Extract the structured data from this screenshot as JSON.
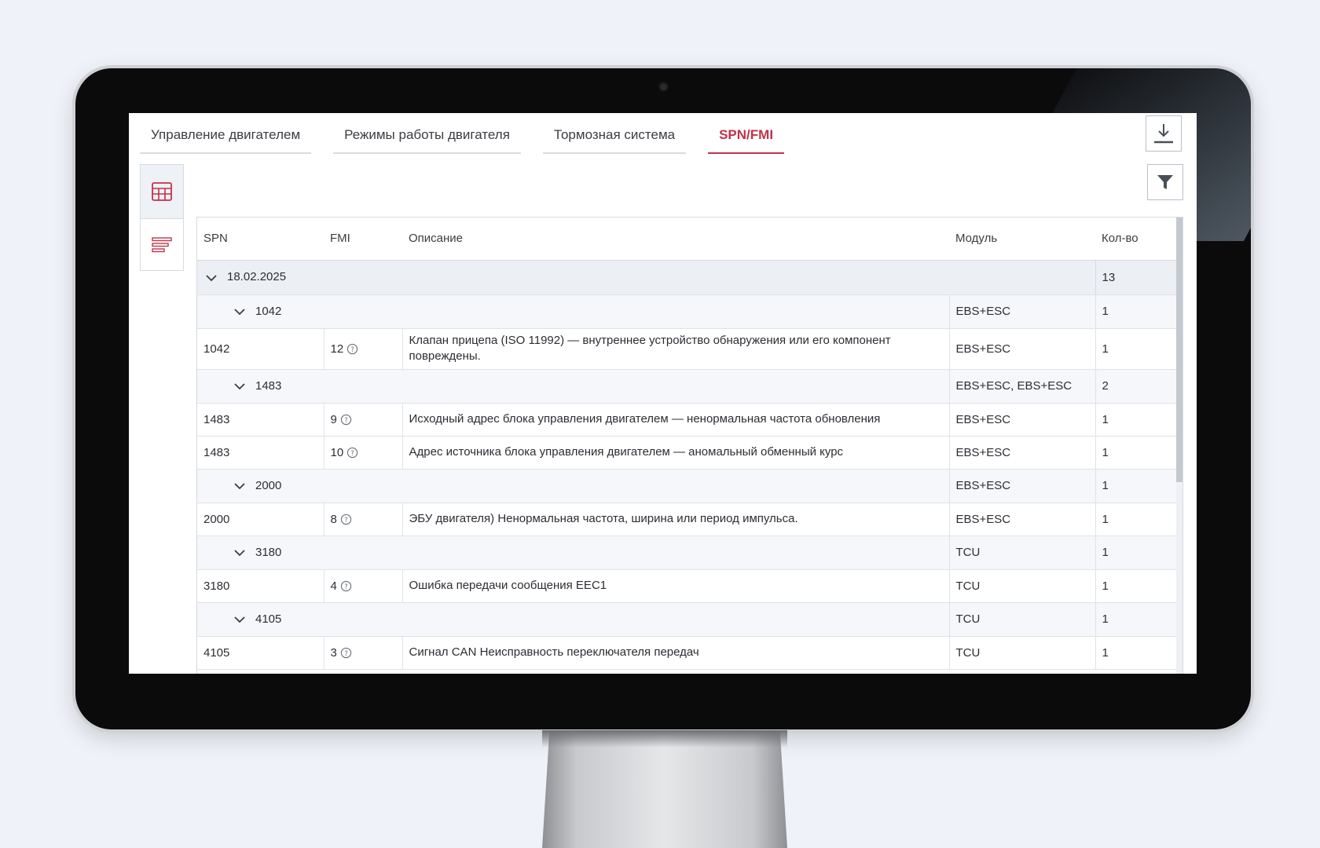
{
  "tabs": [
    {
      "label": "Управление двигателем",
      "active": false
    },
    {
      "label": "Режимы работы двигателя",
      "active": false
    },
    {
      "label": "Тормозная система",
      "active": false
    },
    {
      "label": "SPN/FMI",
      "active": true
    }
  ],
  "toolbar": {
    "download_icon": "download-icon",
    "filter_icon": "filter-icon"
  },
  "view_switch": [
    {
      "icon": "table-view-icon",
      "active": true
    },
    {
      "icon": "list-view-icon",
      "active": false
    }
  ],
  "colors": {
    "accent": "#c0334a",
    "text": "#2b2e33",
    "border": "#d6dae1"
  },
  "table": {
    "headers": {
      "spn": "SPN",
      "fmi": "FMI",
      "desc": "Описание",
      "module": "Модуль",
      "count": "Кол-во"
    },
    "date_group": {
      "date": "18.02.2025",
      "count": "13"
    },
    "groups": [
      {
        "spn": "1042",
        "module": "EBS+ESC",
        "count": "1",
        "rows": [
          {
            "spn": "1042",
            "fmi": "12",
            "desc": "Клапан прицепа (ISO 11992) — внутреннее устройство обнаружения или его компонент повреждены.",
            "module": "EBS+ESC",
            "count": "1"
          }
        ]
      },
      {
        "spn": "1483",
        "module": "EBS+ESC, EBS+ESC",
        "count": "2",
        "rows": [
          {
            "spn": "1483",
            "fmi": "9",
            "desc": "Исходный адрес блока управления двигателем — ненормальная частота обновления",
            "module": "EBS+ESC",
            "count": "1"
          },
          {
            "spn": "1483",
            "fmi": "10",
            "desc": "Адрес источника блока управления двигателем — аномальный обменный курс",
            "module": "EBS+ESC",
            "count": "1"
          }
        ]
      },
      {
        "spn": "2000",
        "module": "EBS+ESC",
        "count": "1",
        "rows": [
          {
            "spn": "2000",
            "fmi": "8",
            "desc": "ЭБУ двигателя) Ненормальная частота, ширина или период импульса.",
            "module": "EBS+ESC",
            "count": "1"
          }
        ]
      },
      {
        "spn": "3180",
        "module": "TCU",
        "count": "1",
        "rows": [
          {
            "spn": "3180",
            "fmi": "4",
            "desc": "Ошибка передачи сообщения EEC1",
            "module": "TCU",
            "count": "1"
          }
        ]
      },
      {
        "spn": "4105",
        "module": "TCU",
        "count": "1",
        "rows": [
          {
            "spn": "4105",
            "fmi": "3",
            "desc": "Сигнал CAN Неисправность переключателя передач",
            "module": "TCU",
            "count": "1"
          }
        ]
      }
    ]
  }
}
